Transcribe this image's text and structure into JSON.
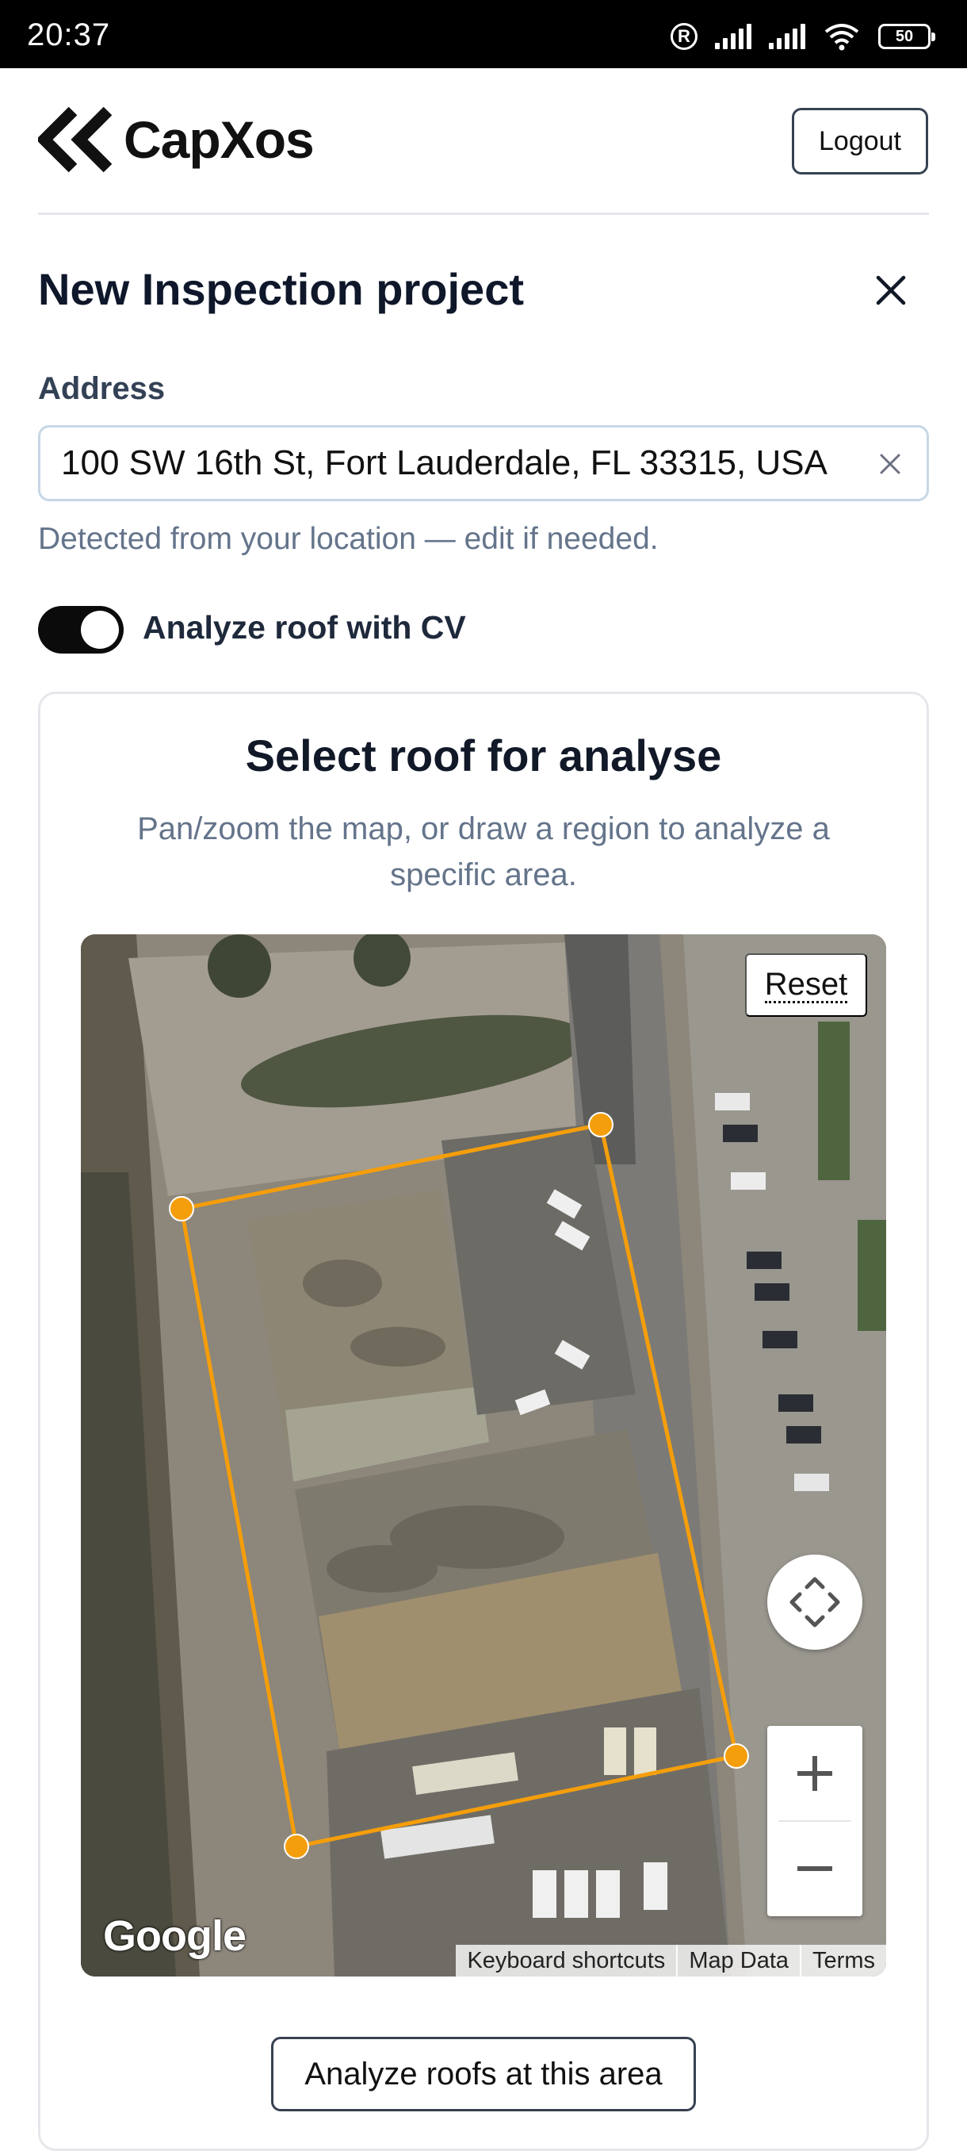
{
  "status_bar": {
    "time": "20:37",
    "battery_level": "50",
    "icons": [
      "registered-icon",
      "signal-icon",
      "signal-icon",
      "wifi-icon",
      "battery-icon"
    ]
  },
  "header": {
    "logo_text": "CapXos",
    "logout_label": "Logout"
  },
  "form": {
    "title": "New Inspection project",
    "address_label": "Address",
    "address_value": "100 SW 16th St, Fort Lauderdale, FL 33315, USA",
    "address_hint": "Detected from your location — edit if needed.",
    "cv_toggle_label": "Analyze roof with CV",
    "cv_toggle_on": true
  },
  "roof_selector": {
    "title": "Select roof for analyse",
    "subtitle": "Pan/zoom the map, or draw a region to analyze a specific area.",
    "reset_label": "Reset",
    "zoom_in_label": "+",
    "zoom_out_label": "−",
    "google_label": "Google",
    "footer_links": [
      "Keyboard shortcuts",
      "Map Data",
      "Terms"
    ],
    "analyze_label": "Analyze roofs at this area",
    "polygon_color": "#f59e0b"
  }
}
